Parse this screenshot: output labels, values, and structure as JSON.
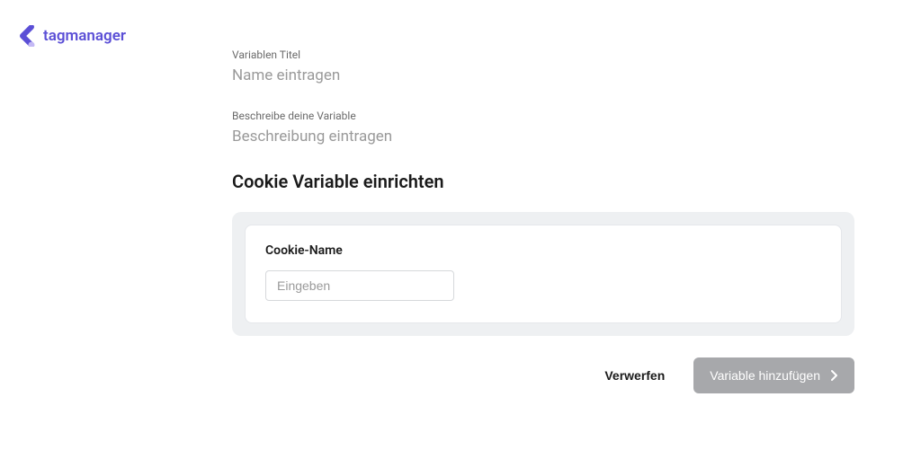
{
  "logo": {
    "text": "tagmanager"
  },
  "fields": {
    "title": {
      "label": "Variablen Titel",
      "placeholder": "Name eintragen"
    },
    "description": {
      "label": "Beschreibe deine Variable",
      "placeholder": "Beschreibung eintragen"
    }
  },
  "section": {
    "title": "Cookie Variable einrichten"
  },
  "card": {
    "cookie_name": {
      "label": "Cookie-Name",
      "placeholder": "Eingeben"
    }
  },
  "actions": {
    "discard": "Verwerfen",
    "submit": "Variable hinzufügen"
  }
}
